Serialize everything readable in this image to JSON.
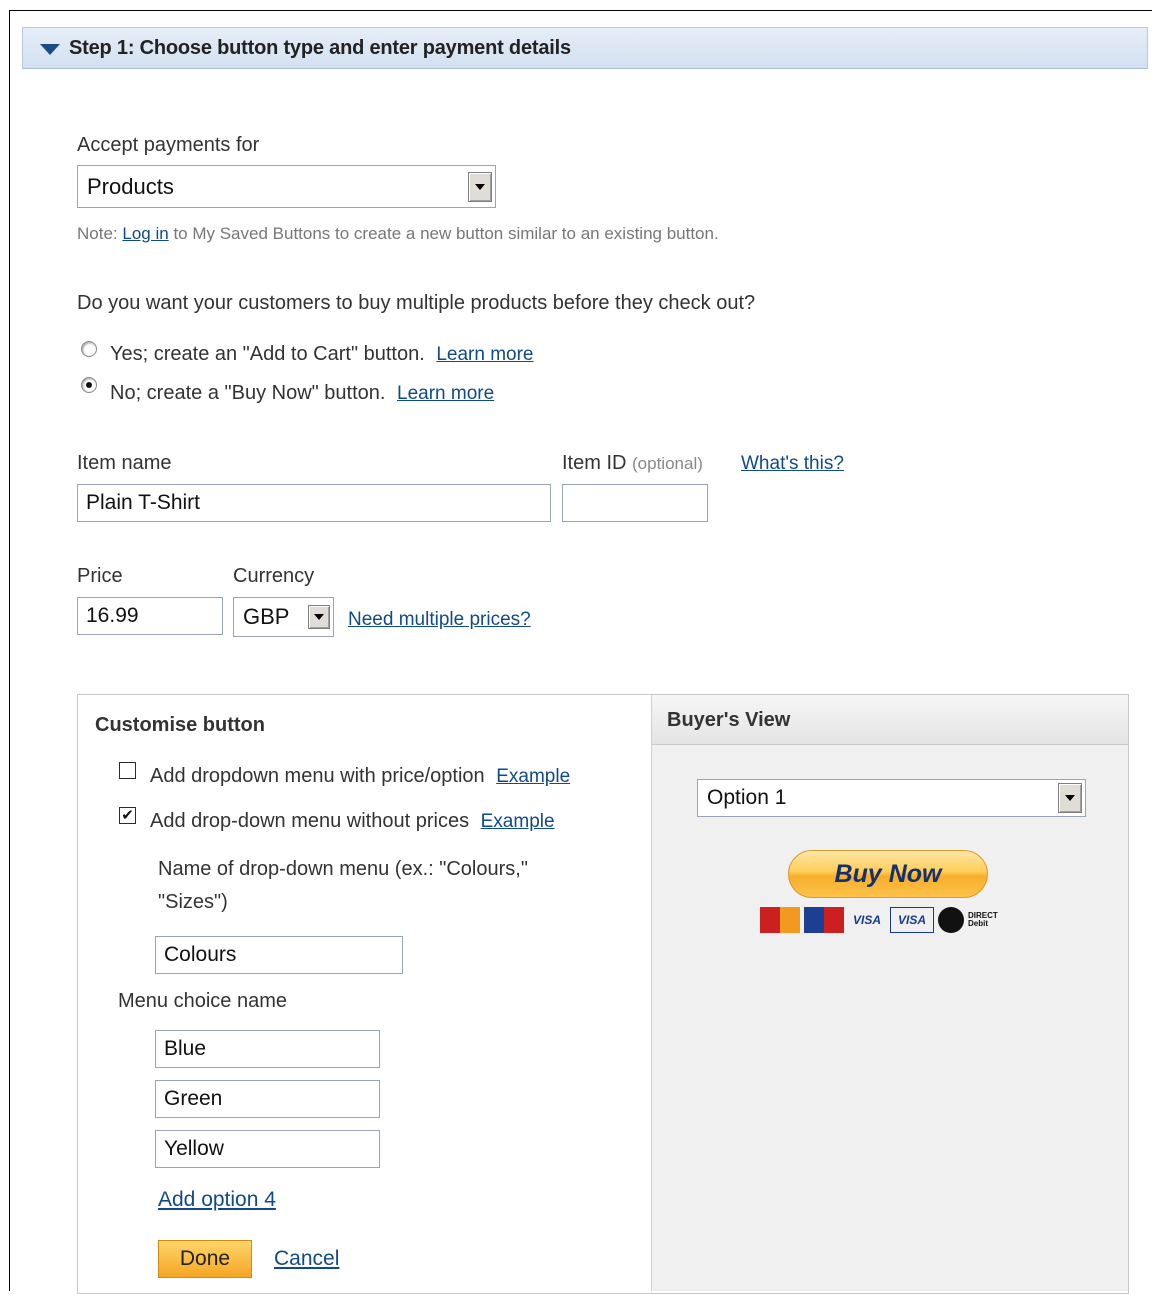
{
  "step": {
    "title": "Step 1: Choose button type and enter payment details"
  },
  "accept": {
    "label": "Accept payments for",
    "value": "Products"
  },
  "note": {
    "prefix": "Note:",
    "link": "Log in",
    "suffix": "to My Saved Buttons to create a new button similar to an existing button."
  },
  "multi": {
    "question": "Do you want your customers to buy multiple products before they check out?",
    "options": [
      {
        "label": "Yes; create an \"Add to Cart\" button.",
        "link": "Learn more",
        "selected": false
      },
      {
        "label": "No; create a \"Buy Now\" button.",
        "link": "Learn more",
        "selected": true
      }
    ]
  },
  "item": {
    "name_label": "Item name",
    "name_value": "Plain T-Shirt",
    "id_label": "Item ID",
    "id_optional": "(optional)",
    "id_value": "",
    "whats_this": "What's this?"
  },
  "price": {
    "label": "Price",
    "value": "16.99",
    "currency_label": "Currency",
    "currency_value": "GBP",
    "multiple_link": "Need multiple prices?"
  },
  "customise": {
    "title": "Customise button",
    "options": [
      {
        "label": "Add dropdown menu with price/option",
        "link": "Example",
        "checked": false
      },
      {
        "label": "Add drop-down menu without prices",
        "link": "Example",
        "checked": true
      }
    ],
    "menu_name_label_1": "Name of drop-down menu (ex.: \"Colours,\"",
    "menu_name_label_2": "\"Sizes\")",
    "menu_name_value": "Colours",
    "choice_label": "Menu choice name",
    "choices": [
      "Blue",
      "Green",
      "Yellow"
    ],
    "add_option": "Add option 4",
    "done": "Done",
    "cancel": "Cancel"
  },
  "buyer": {
    "title": "Buyer's View",
    "dropdown_value": "Option 1",
    "button_label": "Buy Now",
    "cards": [
      "MasterCard",
      "Maestro",
      "VISA",
      "VISA",
      "DIRECT Debit"
    ]
  },
  "colors": {
    "accent_link": "#114a8a",
    "buy_button": "#ffcd57",
    "header_bg": "#d3e0f0"
  }
}
